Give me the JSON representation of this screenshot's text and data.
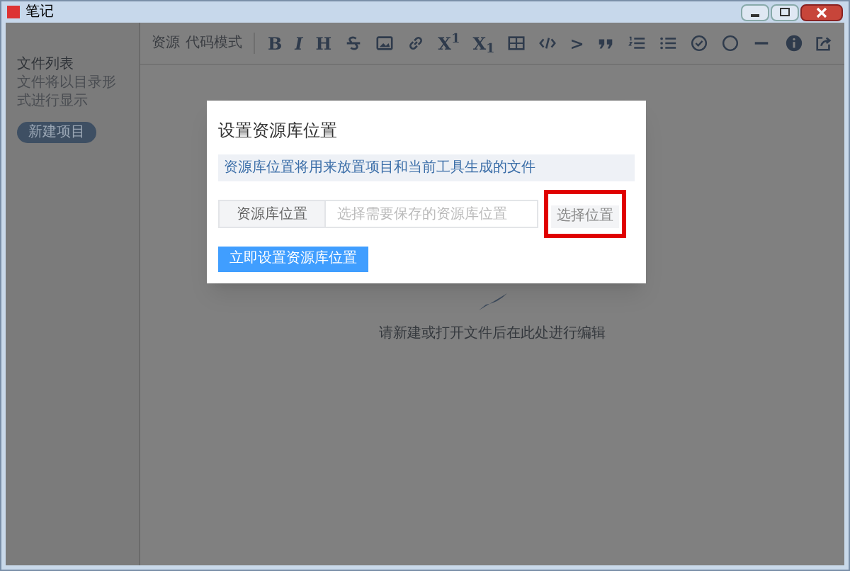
{
  "window": {
    "title": "笔记"
  },
  "toolbar": {
    "modes": [
      "资源",
      "代码模式"
    ],
    "tools": [
      {
        "kind": "text",
        "label": "B"
      },
      {
        "kind": "text",
        "label": "*I*"
      },
      {
        "kind": "text",
        "label": "H"
      },
      {
        "kind": "strike"
      },
      {
        "kind": "image"
      },
      {
        "kind": "link"
      },
      {
        "kind": "text",
        "label": "X$^{1}$"
      },
      {
        "kind": "text",
        "label": "X$_{1}$"
      },
      {
        "kind": "table"
      },
      {
        "kind": "code"
      },
      {
        "kind": "text",
        "label": ">"
      },
      {
        "kind": "quote"
      },
      {
        "kind": "ol"
      },
      {
        "kind": "ul"
      },
      {
        "kind": "check"
      },
      {
        "kind": "circle"
      },
      {
        "kind": "hr"
      }
    ],
    "right_tools": [
      {
        "kind": "info"
      },
      {
        "kind": "share"
      }
    ]
  },
  "sidebar": {
    "title": "文件列表",
    "hint": "文件将以目录形式进行显示",
    "new_button": "新建项目"
  },
  "editor": {
    "empty_hint": "请新建或打开文件后在此处进行编辑"
  },
  "dialog": {
    "title": "设置资源库位置",
    "info": "资源库位置将用来放置项目和当前工具生成的文件",
    "field_label": "资源库位置",
    "placeholder": "选择需要保存的资源库位置",
    "browse_button": "选择位置",
    "browse_highlighted": true,
    "submit_button": "立即设置资源库位置"
  }
}
